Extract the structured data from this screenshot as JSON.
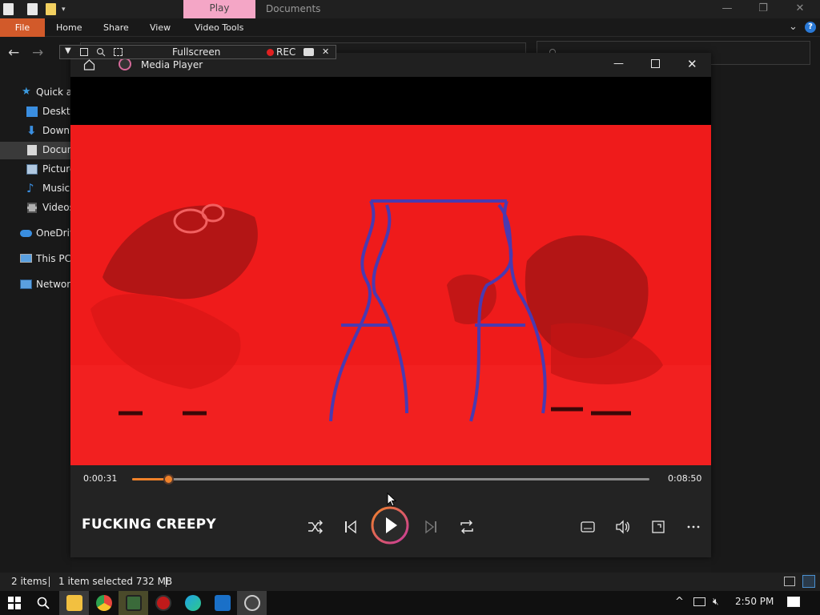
{
  "explorer": {
    "context_tab": "Play",
    "title": "Documents",
    "ribbon_tabs": [
      "File",
      "Home",
      "Share",
      "View",
      "Video Tools"
    ],
    "sidebar": [
      {
        "label": "Quick access",
        "icon": "star-icon",
        "color": "#3c9be0"
      },
      {
        "label": "Desktop",
        "icon": "desktop-icon",
        "color": "#3a8ee0"
      },
      {
        "label": "Downloads",
        "icon": "download-icon",
        "color": "#3a8ee0"
      },
      {
        "label": "Documents",
        "icon": "document-icon",
        "color": "#d8d8d8"
      },
      {
        "label": "Pictures",
        "icon": "picture-icon",
        "color": "#b0c8e0"
      },
      {
        "label": "Music",
        "icon": "music-icon",
        "color": "#3a8ee0"
      },
      {
        "label": "Videos",
        "icon": "video-icon",
        "color": "#b0b0b0"
      },
      {
        "label": "OneDrive",
        "icon": "cloud-icon",
        "color": "#3a8ee0"
      },
      {
        "label": "This PC",
        "icon": "computer-icon",
        "color": "#5aa0e0"
      },
      {
        "label": "Network",
        "icon": "network-icon",
        "color": "#5aa0e0"
      }
    ],
    "status": {
      "items": "2 items",
      "selected": "1 item selected  732 MB"
    }
  },
  "fullscreen_toolbar": {
    "label": "Fullscreen",
    "rec": "REC"
  },
  "player": {
    "title": "Media Player",
    "song": "FUCKING CREEPY",
    "elapsed": "0:00:31",
    "total": "0:08:50",
    "progress_fraction": 0.069
  },
  "taskbar": {
    "time": "2:50 PM"
  },
  "colors": {
    "accent": "#f0822a",
    "video_bg": "#f01a1a",
    "file_tab": "#d25a2a",
    "ctx_tab": "#f4a6c6"
  }
}
